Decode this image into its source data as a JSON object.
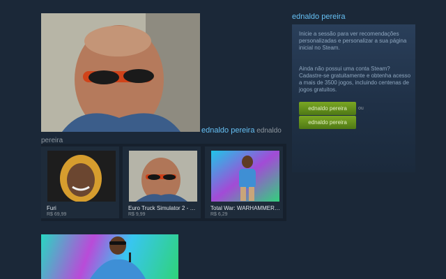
{
  "hero": {
    "caption_link": "ednaldo pereira",
    "caption_text": "ednaldo pereira"
  },
  "tiles": [
    {
      "name": "Furi",
      "price": "R$ 69,99"
    },
    {
      "name": "Euro Truck Simulator 2 - Mi...",
      "price": "R$ 9,99"
    },
    {
      "name": "Total War: WARHAMMER - ...",
      "price": "R$ 6,29"
    }
  ],
  "sidebar": {
    "title": "ednaldo pereira",
    "intro": "Inicie a sessão para ver recomendações personalizadas e personalizar a sua página inicial no Steam.",
    "signup": "Ainda não possui uma conta Steam? Cadastre-se gratuitamente e obtenha acesso a mais de 3500 jogos, incluindo centenas de jogos gratuitos.",
    "button_login": "ednaldo pereira",
    "or": "ou",
    "button_signup": "ednaldo pereira"
  }
}
